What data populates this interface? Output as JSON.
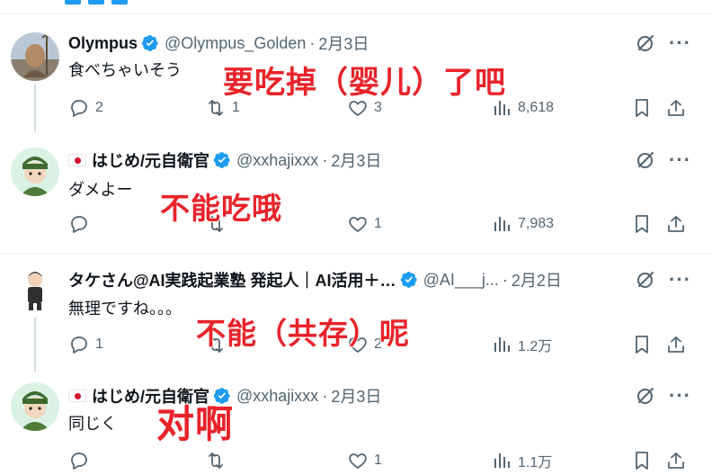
{
  "colors": {
    "accent": "#1d9bf0",
    "text_primary": "#0f1419",
    "text_secondary": "#536471",
    "overlay_text": "#e8232a"
  },
  "icons": {
    "verified": "verified-badge-icon",
    "grok": "grok-icon",
    "more": "more-icon",
    "reply": "reply-icon",
    "repost": "repost-icon",
    "like": "like-icon",
    "views": "views-icon",
    "bookmark": "bookmark-icon",
    "share": "share-icon"
  },
  "tweets": [
    {
      "name": "Olympus",
      "handle": "@Olympus_Golden",
      "separator": "·",
      "date": "2月3日",
      "text": "食べちゃいそう",
      "reply_count": "2",
      "repost_count": "1",
      "like_count": "3",
      "view_count": "8,618",
      "overlay": "要吃掉（婴儿）了吧"
    },
    {
      "name": "はじめ/元自衛官",
      "handle": "@xxhajixxx",
      "separator": "·",
      "date": "2月3日",
      "text": "ダメよー",
      "reply_count": "",
      "repost_count": "",
      "like_count": "1",
      "view_count": "7,983",
      "overlay": "不能吃哦"
    },
    {
      "name": "タケさん@AI実践起業塾 発起人｜AI活用＋…",
      "handle": "@AI___j...",
      "separator": "·",
      "date": "2月2日",
      "text": "無理ですね。。。",
      "reply_count": "1",
      "repost_count": "",
      "like_count": "2",
      "view_count": "1.2万",
      "overlay": "不能（共存）呢"
    },
    {
      "name": "はじめ/元自衛官",
      "handle": "@xxhajixxx",
      "separator": "·",
      "date": "2月3日",
      "text": "同じく",
      "reply_count": "",
      "repost_count": "",
      "like_count": "1",
      "view_count": "1.1万",
      "overlay": "对啊"
    }
  ]
}
